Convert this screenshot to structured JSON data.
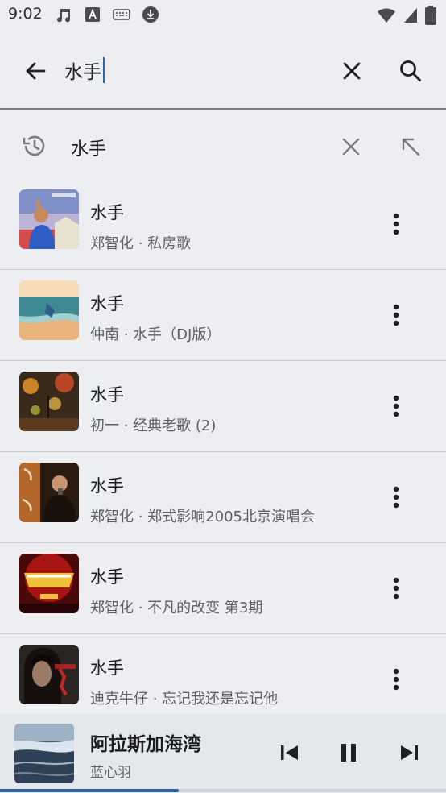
{
  "status_bar": {
    "time": "9:02",
    "left_icons": [
      "music-note-icon",
      "text-a-icon",
      "keyboard-icon",
      "download-icon"
    ],
    "right_icons": [
      "wifi-icon",
      "signal-icon",
      "battery-icon"
    ]
  },
  "search": {
    "query": "水手"
  },
  "history": {
    "term": "水手"
  },
  "results": [
    {
      "title": "水手",
      "subtitle": "郑智化 · 私房歌",
      "cover": "cover-1"
    },
    {
      "title": "水手",
      "subtitle": "仲南 · 水手（DJ版）",
      "cover": "cover-2"
    },
    {
      "title": "水手",
      "subtitle": "初一 · 经典老歌 (2)",
      "cover": "cover-3"
    },
    {
      "title": "水手",
      "subtitle": "郑智化 · 郑式影响2005北京演唱会",
      "cover": "cover-4"
    },
    {
      "title": "水手",
      "subtitle": "郑智化 · 不凡的改变 第3期",
      "cover": "cover-5"
    },
    {
      "title": "水手",
      "subtitle": "迪克牛仔 · 忘记我还是忘记他",
      "cover": "cover-6"
    }
  ],
  "player": {
    "title": "阿拉斯加海湾",
    "artist": "蓝心羽",
    "progress": 0.4
  },
  "colors": {
    "background": "#eceef1",
    "accent": "#2f5fa8",
    "text_primary": "#1b1c1f",
    "text_secondary": "#5d5f63"
  }
}
